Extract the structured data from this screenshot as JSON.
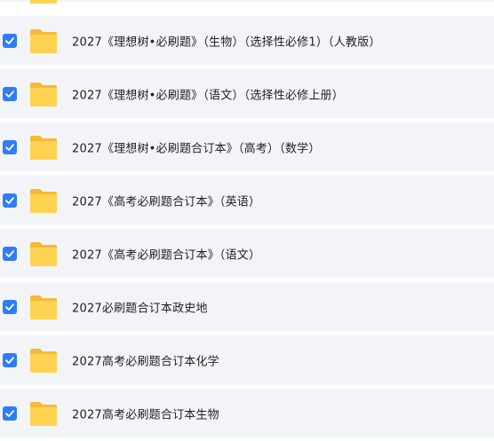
{
  "files": [
    {
      "name": "2027《理想树•必刷题》（生物）（选择性必修1）（人教版）",
      "checked": true,
      "icon": "folder-icon"
    },
    {
      "name": "2027《理想树•必刷题》（语文）（选择性必修上册）",
      "checked": true,
      "icon": "folder-icon"
    },
    {
      "name": "2027《理想树•必刷题合订本》（高考）（数学）",
      "checked": true,
      "icon": "folder-icon"
    },
    {
      "name": "2027《高考必刷题合订本》（英语）",
      "checked": true,
      "icon": "folder-icon"
    },
    {
      "name": "2027《高考必刷题合订本》（语文）",
      "checked": true,
      "icon": "folder-icon"
    },
    {
      "name": "2027必刷题合订本政史地",
      "checked": true,
      "icon": "folder-icon"
    },
    {
      "name": "2027高考必刷题合订本化学",
      "checked": true,
      "icon": "folder-icon"
    },
    {
      "name": "2027高考必刷题合订本生物",
      "checked": true,
      "icon": "folder-icon"
    }
  ],
  "colors": {
    "checkbox": "#2f7df6",
    "row_background": "#f3f4f8",
    "folder_back": "#f5b93a",
    "folder_front": "#ffd24f"
  }
}
